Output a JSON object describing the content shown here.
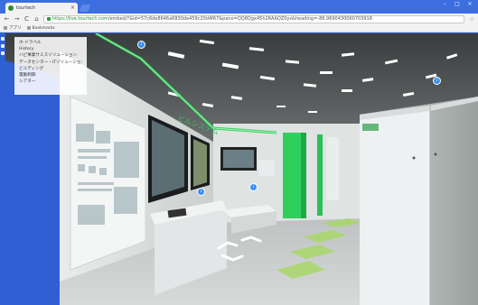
{
  "browser": {
    "tab_title": "tourtech",
    "tab_close": "×",
    "window_minimize": "–",
    "window_maximize": "□",
    "window_close": "×",
    "nav_back": "←",
    "nav_forward": "→",
    "nav_reload": "C",
    "nav_home": "⌂",
    "url_secure": "https://live.tourtech.com",
    "url_rest": "/embed/?&id=57c6de8646a6830de459c20d4f67&pano=QQ8Qgx45h2RAAQZ0yz&heading=-86.9690430060703918",
    "bookmark_star": "☆",
    "bookmarks": [
      {
        "label": "アプリ"
      },
      {
        "label": "Bookmarks"
      }
    ]
  },
  "menu": {
    "items": [
      "ホ-ドラベル",
      "History",
      "ハピ事業サミスソリューション",
      "データセンター・ITソリューション",
      "ビルディング",
      "電動制御",
      "シアター"
    ]
  },
  "scene": {
    "wall_sign_1": "ビルシステム",
    "hotspot_glyph": "i"
  },
  "colors": {
    "frame": "#2f5fd3",
    "accent_green": "#2ecc55",
    "hotspot": "#3c8df0"
  }
}
